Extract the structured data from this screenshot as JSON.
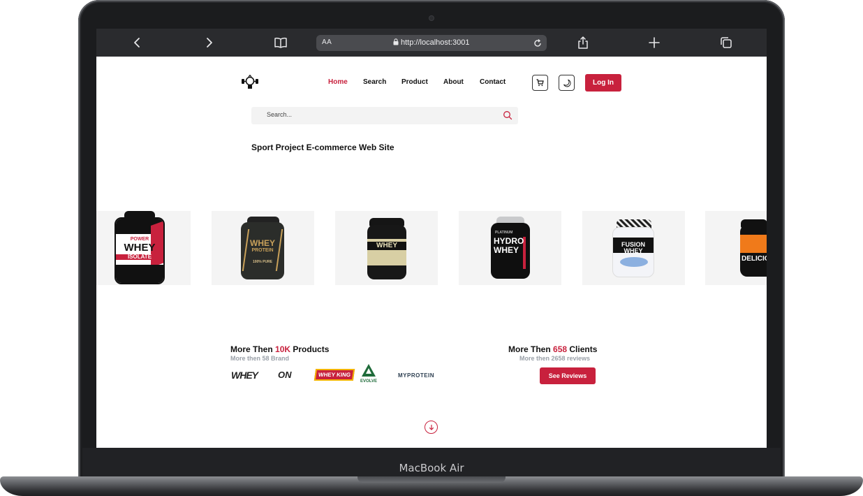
{
  "device": {
    "label": "MacBook Air"
  },
  "browser": {
    "reader_label": "AA",
    "url": "http://localhost:3001",
    "icons": [
      "back-icon",
      "forward-icon",
      "book-icon",
      "lock-icon",
      "reload-icon",
      "share-icon",
      "new-tab-icon",
      "tabs-icon"
    ]
  },
  "header": {
    "nav": [
      "Home",
      "Search",
      "Product",
      "About",
      "Contact"
    ],
    "active_nav": "Home",
    "login_label": "Log In",
    "icons": [
      "cart-icon",
      "theme-toggle-icon"
    ]
  },
  "search": {
    "placeholder": "Search..."
  },
  "hero": {
    "title": "Sport Project E-commerce Web Site"
  },
  "products": [
    {
      "brand": "POWER",
      "name": "WHEY",
      "sub": "ISOLATE"
    },
    {
      "name": "WHEY",
      "sub": "PROTEIN",
      "extra": "100% PURE"
    },
    {
      "name": "WHEY"
    },
    {
      "brand": "PLATINUM",
      "name": "HYDRO",
      "sub": "WHEY"
    },
    {
      "name": "FUSION WHEY"
    },
    {
      "name": "DELICIOU"
    }
  ],
  "stats": {
    "products": {
      "prefix": "More Then ",
      "value": "10K",
      "suffix": " Products",
      "sub": "More then 58 Brand"
    },
    "clients": {
      "prefix": "More Then ",
      "value": "658",
      "suffix": " Clients",
      "sub": "More then 2658 reviews"
    }
  },
  "brands": [
    "WHEY",
    "ON",
    "WHEY KING",
    "EVOLVE",
    "MYPROTEIN"
  ],
  "reviews_button": "See Reviews",
  "colors": {
    "accent": "#c8213d",
    "toolbar": "#2a2b2e"
  }
}
